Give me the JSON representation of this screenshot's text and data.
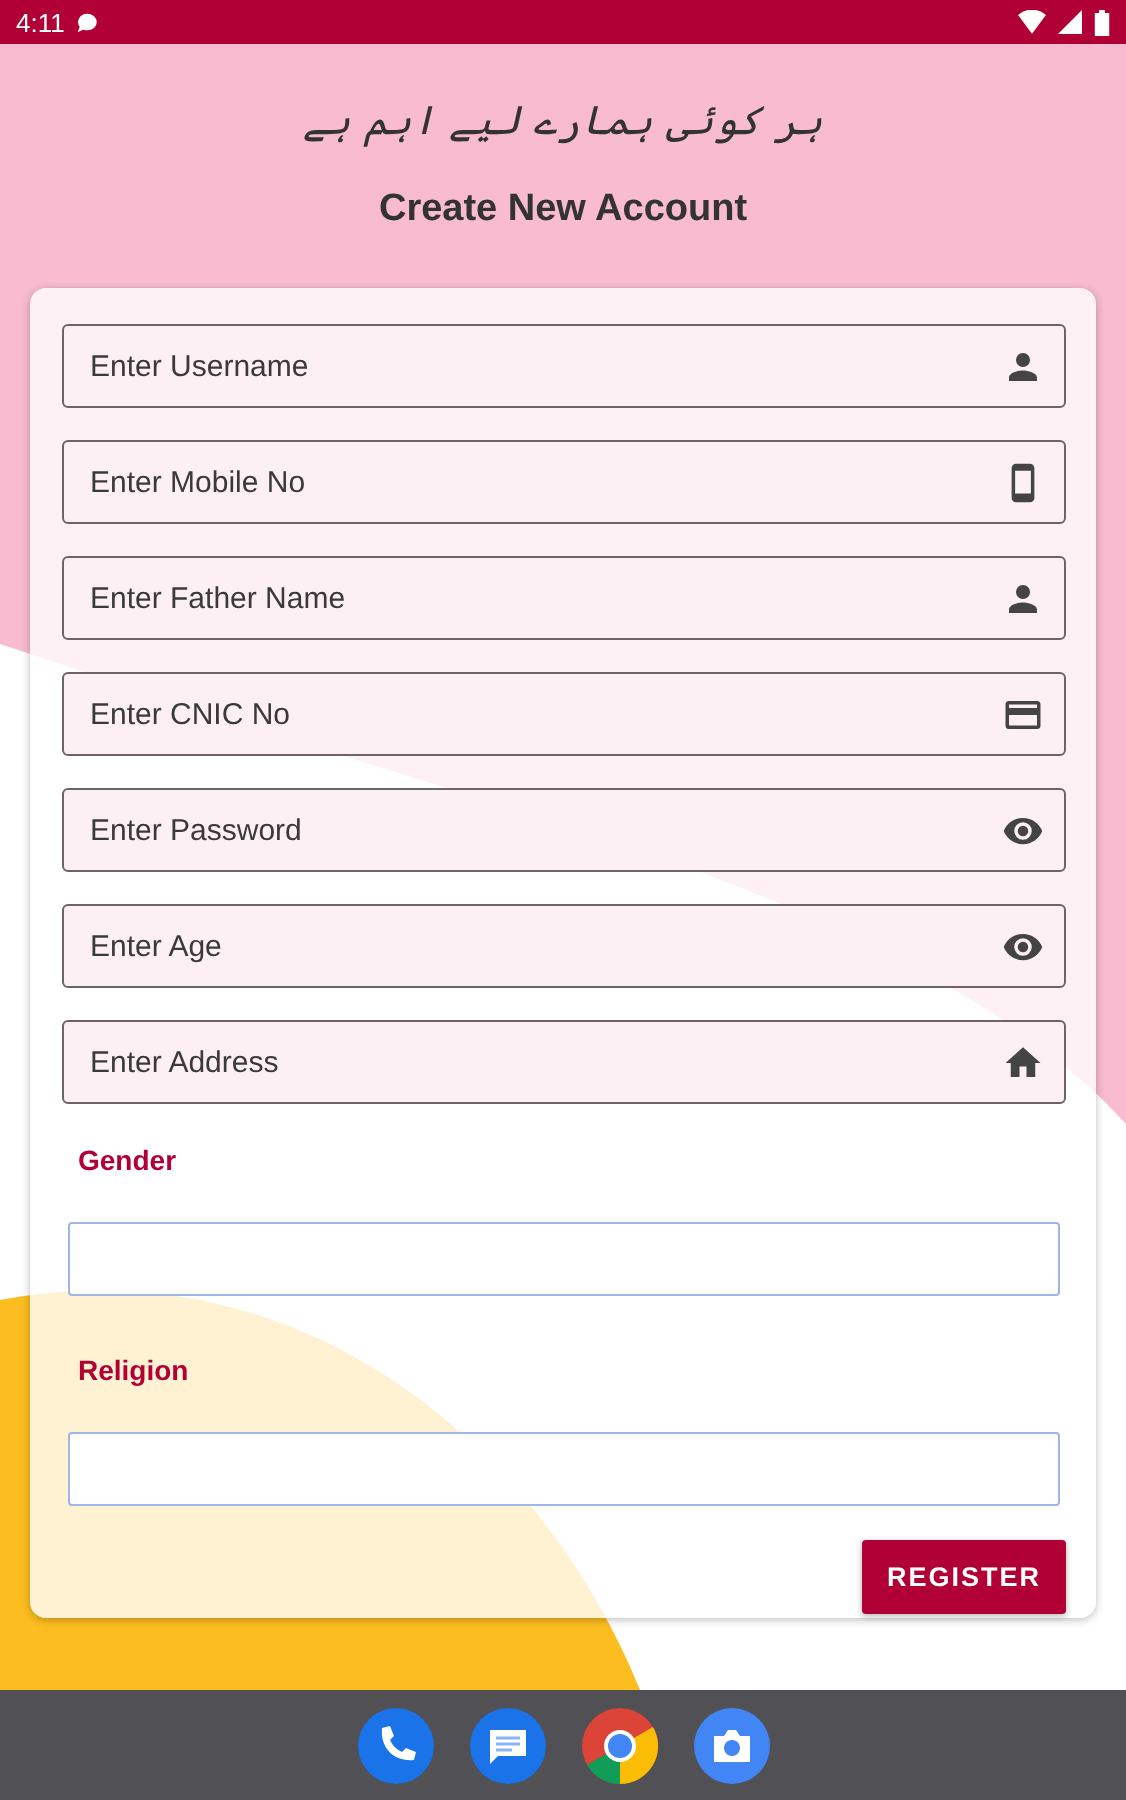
{
  "status_bar": {
    "time": "4:11"
  },
  "slogan": "ہر کوئی ہمارے لیے اہم ہے",
  "title": "Create New Account",
  "fields": [
    {
      "placeholder": "Enter Username",
      "kind": "person"
    },
    {
      "placeholder": "Enter Mobile No",
      "kind": "phone"
    },
    {
      "placeholder": "Enter Father Name",
      "kind": "person"
    },
    {
      "placeholder": "Enter CNIC No",
      "kind": "card"
    },
    {
      "placeholder": "Enter Password",
      "kind": "eye"
    },
    {
      "placeholder": "Enter Age",
      "kind": "eye"
    },
    {
      "placeholder": "Enter Address",
      "kind": "home"
    }
  ],
  "dropdowns": [
    {
      "label": "Gender"
    },
    {
      "label": "Religion"
    }
  ],
  "button": "REGISTER"
}
